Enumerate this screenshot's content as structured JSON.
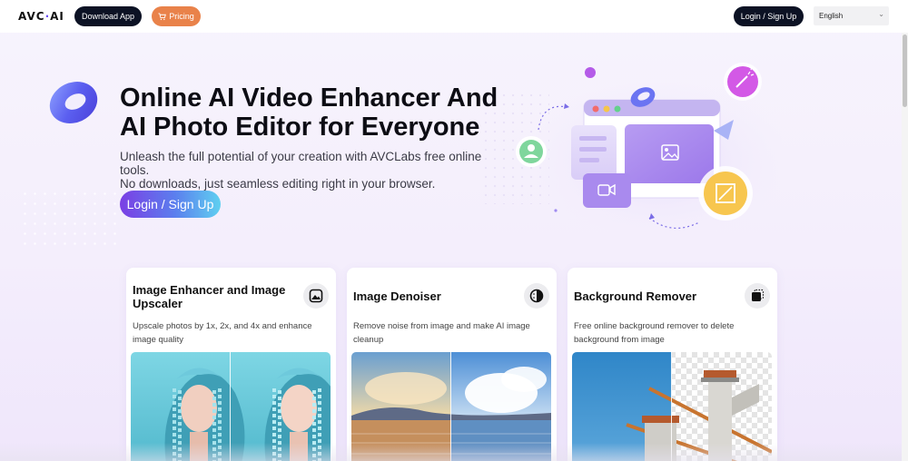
{
  "header": {
    "logo_text": "AVC",
    "logo_dot": "·",
    "logo_suffix": "AI",
    "download_label": "Download App",
    "pricing_label": "Pricing",
    "login_label": "Login / Sign Up",
    "language": "English"
  },
  "hero": {
    "title_line1": "Online AI Video Enhancer And",
    "title_line2": "AI Photo Editor for Everyone",
    "subtitle_line1": "Unleash the full potential of your creation with AVCLabs free online tools.",
    "subtitle_line2": "No downloads, just seamless editing right in your browser.",
    "cta_label": "Login / Sign Up"
  },
  "cards": [
    {
      "title": "Image Enhancer and Image Upscaler",
      "description": "Upscale photos by 1x, 2x, and 4x and enhance image quality",
      "icon": "mountain-image-icon"
    },
    {
      "title": "Image Denoiser",
      "description": "Remove noise from image and make AI image cleanup",
      "icon": "denoise-circle-icon"
    },
    {
      "title": "Background Remover",
      "description": "Free online background remover to delete background from image",
      "icon": "background-remove-icon"
    }
  ],
  "colors": {
    "brand_dark": "#0c1224",
    "pricing_orange": "#e9824a",
    "accent_purple": "#7b3fe4",
    "accent_cyan": "#5fd0f0"
  }
}
